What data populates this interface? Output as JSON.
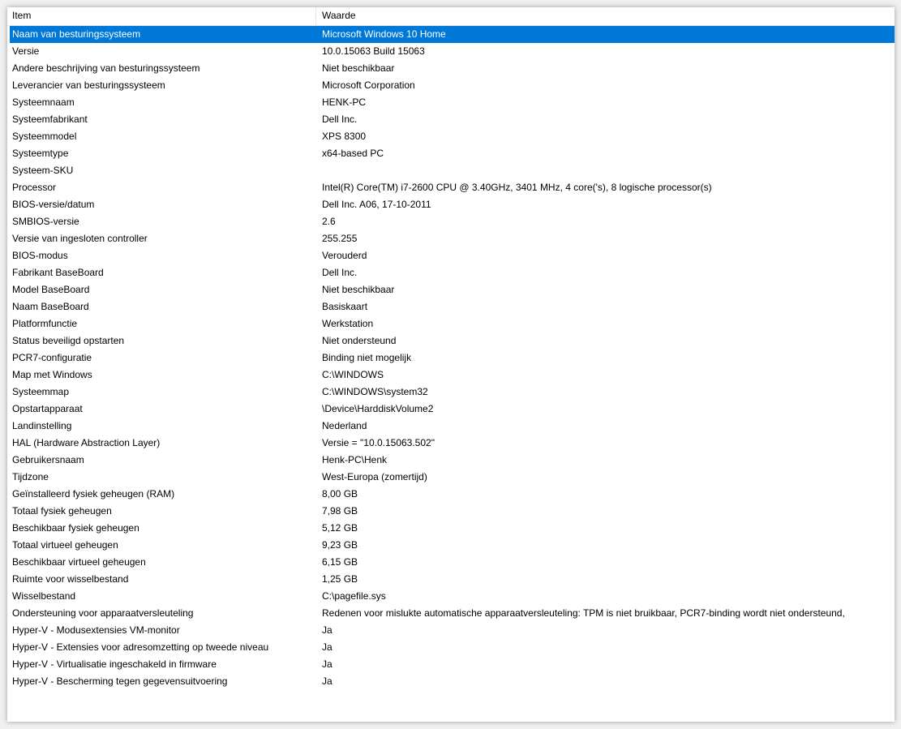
{
  "header": {
    "item": "Item",
    "value": "Waarde"
  },
  "selected_index": 0,
  "colors": {
    "selection": "#0078d7"
  },
  "rows": [
    {
      "item": "Naam van besturingssysteem",
      "value": "Microsoft Windows 10 Home"
    },
    {
      "item": "Versie",
      "value": "10.0.15063 Build 15063"
    },
    {
      "item": "Andere beschrijving van besturingssysteem",
      "value": "Niet beschikbaar"
    },
    {
      "item": "Leverancier van besturingssysteem",
      "value": "Microsoft Corporation"
    },
    {
      "item": "Systeemnaam",
      "value": "HENK-PC"
    },
    {
      "item": "Systeemfabrikant",
      "value": "Dell Inc."
    },
    {
      "item": "Systeemmodel",
      "value": "XPS 8300"
    },
    {
      "item": "Systeemtype",
      "value": "x64-based PC"
    },
    {
      "item": "Systeem-SKU",
      "value": ""
    },
    {
      "item": "Processor",
      "value": "Intel(R) Core(TM) i7-2600 CPU @ 3.40GHz, 3401 MHz, 4 core('s), 8 logische processor(s)"
    },
    {
      "item": "BIOS-versie/datum",
      "value": "Dell Inc. A06, 17-10-2011"
    },
    {
      "item": "SMBIOS-versie",
      "value": "2.6"
    },
    {
      "item": "Versie van ingesloten controller",
      "value": "255.255"
    },
    {
      "item": "BIOS-modus",
      "value": "Verouderd"
    },
    {
      "item": "Fabrikant BaseBoard",
      "value": "Dell Inc."
    },
    {
      "item": "Model BaseBoard",
      "value": "Niet beschikbaar"
    },
    {
      "item": "Naam BaseBoard",
      "value": "Basiskaart"
    },
    {
      "item": "Platformfunctie",
      "value": "Werkstation"
    },
    {
      "item": "Status beveiligd opstarten",
      "value": "Niet ondersteund"
    },
    {
      "item": "PCR7-configuratie",
      "value": "Binding niet mogelijk"
    },
    {
      "item": "Map met Windows",
      "value": "C:\\WINDOWS"
    },
    {
      "item": "Systeemmap",
      "value": "C:\\WINDOWS\\system32"
    },
    {
      "item": "Opstartapparaat",
      "value": "\\Device\\HarddiskVolume2"
    },
    {
      "item": "Landinstelling",
      "value": "Nederland"
    },
    {
      "item": "HAL (Hardware Abstraction Layer)",
      "value": "Versie = \"10.0.15063.502\""
    },
    {
      "item": "Gebruikersnaam",
      "value": "Henk-PC\\Henk"
    },
    {
      "item": "Tijdzone",
      "value": "West-Europa (zomertijd)"
    },
    {
      "item": "Geïnstalleerd fysiek geheugen (RAM)",
      "value": "8,00 GB"
    },
    {
      "item": "Totaal fysiek geheugen",
      "value": "7,98 GB"
    },
    {
      "item": "Beschikbaar fysiek geheugen",
      "value": "5,12 GB"
    },
    {
      "item": "Totaal virtueel geheugen",
      "value": "9,23 GB"
    },
    {
      "item": "Beschikbaar virtueel geheugen",
      "value": "6,15 GB"
    },
    {
      "item": "Ruimte voor wisselbestand",
      "value": "1,25 GB"
    },
    {
      "item": "Wisselbestand",
      "value": "C:\\pagefile.sys"
    },
    {
      "item": "Ondersteuning voor apparaatversleuteling",
      "value": "Redenen voor mislukte automatische apparaatversleuteling: TPM is niet bruikbaar, PCR7-binding wordt niet ondersteund,"
    },
    {
      "item": "Hyper-V - Modusextensies VM-monitor",
      "value": "Ja"
    },
    {
      "item": "Hyper-V - Extensies voor adresomzetting op tweede niveau",
      "value": "Ja"
    },
    {
      "item": "Hyper-V - Virtualisatie ingeschakeld in firmware",
      "value": "Ja"
    },
    {
      "item": "Hyper-V - Bescherming tegen gegevensuitvoering",
      "value": "Ja"
    }
  ]
}
